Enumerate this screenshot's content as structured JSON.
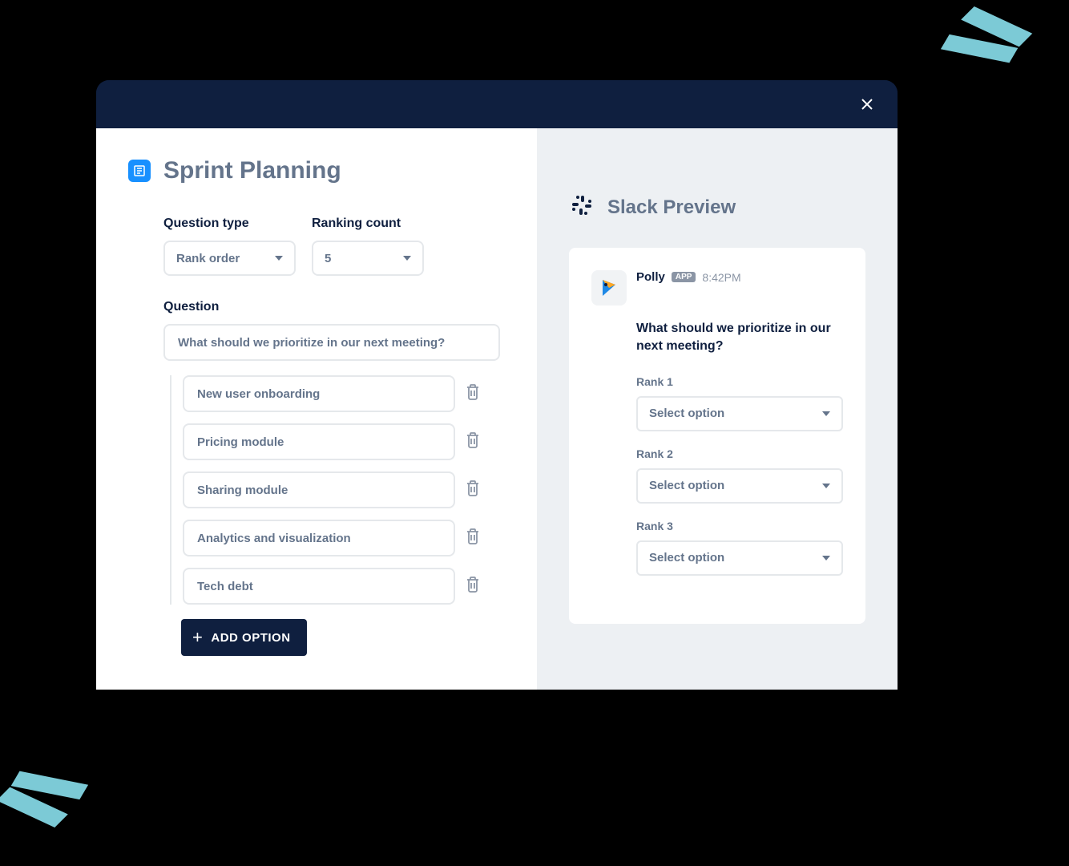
{
  "header": {
    "title": "Sprint Planning"
  },
  "form": {
    "question_type": {
      "label": "Question type",
      "value": "Rank order"
    },
    "ranking_count": {
      "label": "Ranking count",
      "value": "5"
    },
    "question": {
      "label": "Question",
      "value": "What should we prioritize in our next meeting?"
    },
    "options": [
      "New user onboarding",
      "Pricing module",
      "Sharing module",
      "Analytics and visualization",
      "Tech debt"
    ],
    "add_button": "ADD OPTION"
  },
  "preview": {
    "title": "Slack Preview",
    "app_name": "Polly",
    "app_badge": "APP",
    "timestamp": "8:42PM",
    "question": "What should we prioritize in our next meeting?",
    "ranks": [
      {
        "label": "Rank 1",
        "placeholder": "Select option"
      },
      {
        "label": "Rank 2",
        "placeholder": "Select option"
      },
      {
        "label": "Rank 3",
        "placeholder": "Select option"
      }
    ]
  }
}
